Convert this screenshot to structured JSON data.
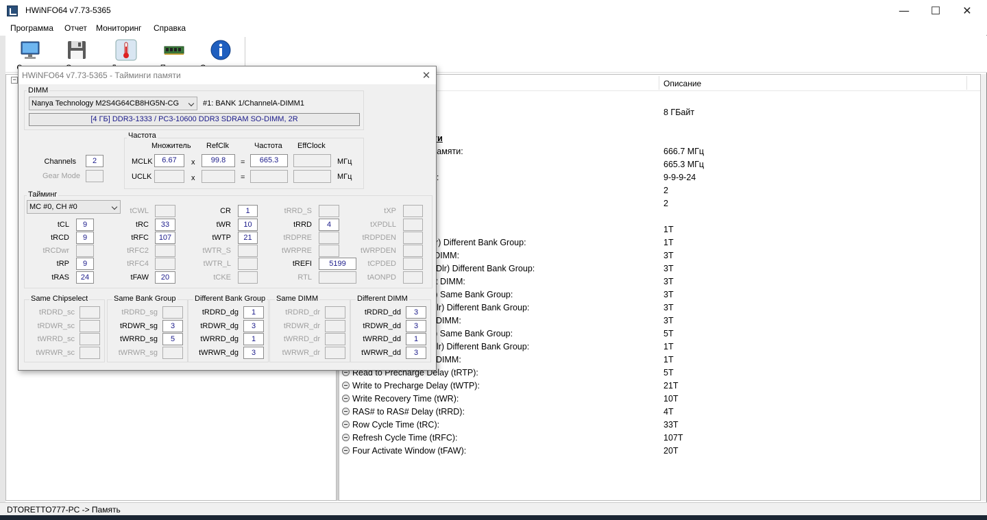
{
  "window": {
    "title": "HWiNFO64 v7.73-5365",
    "minimize": "—",
    "maximize": "☐",
    "close": "✕"
  },
  "menu": [
    "Программа",
    "Отчет",
    "Мониторинг",
    "Справка"
  ],
  "toolbar": {
    "buttons": [
      {
        "label": "Сводка",
        "icon": "monitor-icon"
      },
      {
        "label": "Отчет",
        "icon": "floppy-disk-icon"
      },
      {
        "label": "Датчики",
        "icon": "thermometer-icon"
      },
      {
        "label": "Память",
        "icon": "ram-module-icon"
      },
      {
        "label": "О программе",
        "icon": "info-icon"
      }
    ]
  },
  "tree": {
    "collapse": "−"
  },
  "right_pane": {
    "column_description": "Описание",
    "rows": [
      {
        "a": "ия",
        "b": "",
        "kind": "section"
      },
      {
        "a": ":",
        "b": "8 ГБайт",
        "kind": "plain"
      },
      {
        "a": "",
        "b": "",
        "kind": "blank"
      },
      {
        "a": " производительности",
        "b": "",
        "kind": "section"
      },
      {
        "a": "рживаемая частота памяти:",
        "b": "666.7 МГц",
        "kind": "plain"
      },
      {
        "a": "мяти:",
        "b": "665.3 МГц",
        "kind": "plain"
      },
      {
        "a": "CAS-tRCD-tRP-tRAS):",
        "b": "9-9-9-24",
        "kind": "plain"
      },
      {
        "a": "налы памяти:",
        "b": "2",
        "kind": "plain"
      },
      {
        "a": "мяти:",
        "b": "2",
        "kind": "plain"
      },
      {
        "a": "",
        "b": "",
        "kind": "blank"
      },
      {
        "a": "(CR):",
        "b": "1T",
        "kind": "plain"
      },
      {
        "a": "RDRD_DG/TrdrdScDlr) Different Bank Group:",
        "b": "1T",
        "kind": "plain"
      },
      {
        "a": "RDRD_DD) Different DIMM:",
        "b": "3T",
        "kind": "plain"
      },
      {
        "a": "tWRWR_DG/TwrwrScDlr) Different Bank Group:",
        "b": "3T",
        "kind": "plain"
      },
      {
        "a": "tWRWR_DD) Different DIMM:",
        "b": "3T",
        "kind": "plain"
      },
      {
        "a": "RDWR_SG/TrdwrScL) Same Bank Group:",
        "b": "3T",
        "kind": "plain"
      },
      {
        "a": "RDWR_DG/TrdwrScDlr) Different Bank Group:",
        "b": "3T",
        "kind": "plain"
      },
      {
        "a": "RDWR_DD) Different DIMM:",
        "b": "3T",
        "kind": "plain"
      },
      {
        "a": "WRRD_SG/TwrrdScL) Same Bank Group:",
        "b": "5T",
        "kind": "plain"
      },
      {
        "a": "WRRD_DG/TwrrdScDlr) Different Bank Group:",
        "b": "1T",
        "kind": "plain"
      },
      {
        "a": "WRRD_DD) Different DIMM:",
        "b": "1T",
        "kind": "plain"
      },
      {
        "a": "Read to Precharge Delay (tRTP):",
        "b": "5T",
        "kind": "bullet"
      },
      {
        "a": "Write to Precharge Delay (tWTP):",
        "b": "21T",
        "kind": "bullet"
      },
      {
        "a": "Write Recovery Time (tWR):",
        "b": "10T",
        "kind": "bullet"
      },
      {
        "a": "RAS# to RAS# Delay (tRRD):",
        "b": "4T",
        "kind": "bullet"
      },
      {
        "a": "Row Cycle Time (tRC):",
        "b": "33T",
        "kind": "bullet"
      },
      {
        "a": "Refresh Cycle Time (tRFC):",
        "b": "107T",
        "kind": "bullet"
      },
      {
        "a": "Four Activate Window (tFAW):",
        "b": "20T",
        "kind": "bullet"
      }
    ]
  },
  "status_bar": "DTORETTO777-PC -> Память",
  "dialog": {
    "title": "HWiNFO64 v7.73-5365 - Тайминги памяти",
    "close": "✕",
    "dimm_group": "DIMM",
    "dimm_select": "Nanya Technology M2S4G64CB8HG5N-CG",
    "dimm_slot": "#1: BANK 1/ChannelA-DIMM1",
    "dimm_info": "[4 ГБ] DDR3-1333 / PC3-10600 DDR3 SDRAM SO-DIMM, 2R",
    "channels_label": "Channels",
    "channels_value": "2",
    "gear_mode_label": "Gear Mode",
    "gear_mode_value": "",
    "freq_group": "Частота",
    "freq_headers": [
      "Множитель",
      "RefClk",
      "Частота",
      "EffClock"
    ],
    "mclk": {
      "label": "MCLK",
      "mult": "6.67",
      "x": "x",
      "refclk": "99.8",
      "eq": "=",
      "freq": "665.3",
      "eff": "",
      "unit": "МГц"
    },
    "uclk": {
      "label": "UCLK",
      "mult": "",
      "x": "x",
      "refclk": "",
      "eq": "=",
      "freq": "",
      "eff": "",
      "unit": "МГц"
    },
    "timing_group": "Тайминг",
    "mc_select": "MC #0, CH #0",
    "timings": {
      "tCL": {
        "label": "tCL",
        "value": "9",
        "active": true
      },
      "tRCD": {
        "label": "tRCD",
        "value": "9",
        "active": true
      },
      "tRCDwr": {
        "label": "tRCDwr",
        "value": "",
        "active": false
      },
      "tRP": {
        "label": "tRP",
        "value": "9",
        "active": true
      },
      "tRAS": {
        "label": "tRAS",
        "value": "24",
        "active": true
      },
      "tCWL": {
        "label": "tCWL",
        "value": "",
        "active": false
      },
      "tRC": {
        "label": "tRC",
        "value": "33",
        "active": true
      },
      "tRFC": {
        "label": "tRFC",
        "value": "107",
        "active": true
      },
      "tRFC2": {
        "label": "tRFC2",
        "value": "",
        "active": false
      },
      "tRFC4": {
        "label": "tRFC4",
        "value": "",
        "active": false
      },
      "tFAW": {
        "label": "tFAW",
        "value": "20",
        "active": true
      },
      "CR": {
        "label": "CR",
        "value": "1",
        "active": true
      },
      "tWR": {
        "label": "tWR",
        "value": "10",
        "active": true
      },
      "tWTP": {
        "label": "tWTP",
        "value": "21",
        "active": true
      },
      "tWTR_S": {
        "label": "tWTR_S",
        "value": "",
        "active": false
      },
      "tWTR_L": {
        "label": "tWTR_L",
        "value": "",
        "active": false
      },
      "tCKE": {
        "label": "tCKE",
        "value": "",
        "active": false
      },
      "tRRD_S": {
        "label": "tRRD_S",
        "value": "",
        "active": false
      },
      "tRRD": {
        "label": "tRRD",
        "value": "4",
        "active": true
      },
      "tRDPRE": {
        "label": "tRDPRE",
        "value": "",
        "active": false
      },
      "tWRPRE": {
        "label": "tWRPRE",
        "value": "",
        "active": false
      },
      "tREFI": {
        "label": "tREFI",
        "value": "5199",
        "active": true
      },
      "RTL": {
        "label": "RTL",
        "value": "",
        "active": false
      },
      "tXP": {
        "label": "tXP",
        "value": "",
        "active": false
      },
      "tXPDLL": {
        "label": "tXPDLL",
        "value": "",
        "active": false
      },
      "tRDPDEN": {
        "label": "tRDPDEN",
        "value": "",
        "active": false
      },
      "tWRPDEN": {
        "label": "tWRPDEN",
        "value": "",
        "active": false
      },
      "tCPDED": {
        "label": "tCPDED",
        "value": "",
        "active": false
      },
      "tAONPD": {
        "label": "tAONPD",
        "value": "",
        "active": false
      }
    },
    "groups": [
      {
        "title": "Same Chipselect",
        "items": [
          {
            "label": "tRDRD_sc",
            "value": "",
            "active": false
          },
          {
            "label": "tRDWR_sc",
            "value": "",
            "active": false
          },
          {
            "label": "tWRRD_sc",
            "value": "",
            "active": false
          },
          {
            "label": "tWRWR_sc",
            "value": "",
            "active": false
          }
        ]
      },
      {
        "title": "Same Bank Group",
        "items": [
          {
            "label": "tRDRD_sg",
            "value": "",
            "active": false
          },
          {
            "label": "tRDWR_sg",
            "value": "3",
            "active": true
          },
          {
            "label": "tWRRD_sg",
            "value": "5",
            "active": true
          },
          {
            "label": "tWRWR_sg",
            "value": "",
            "active": false
          }
        ]
      },
      {
        "title": "Different Bank Group",
        "items": [
          {
            "label": "tRDRD_dg",
            "value": "1",
            "active": true
          },
          {
            "label": "tRDWR_dg",
            "value": "3",
            "active": true
          },
          {
            "label": "tWRRD_dg",
            "value": "1",
            "active": true
          },
          {
            "label": "tWRWR_dg",
            "value": "3",
            "active": true
          }
        ]
      },
      {
        "title": "Same DIMM",
        "items": [
          {
            "label": "tRDRD_dr",
            "value": "",
            "active": false
          },
          {
            "label": "tRDWR_dr",
            "value": "",
            "active": false
          },
          {
            "label": "tWRRD_dr",
            "value": "",
            "active": false
          },
          {
            "label": "tWRWR_dr",
            "value": "",
            "active": false
          }
        ]
      },
      {
        "title": "Different DIMM",
        "items": [
          {
            "label": "tRDRD_dd",
            "value": "3",
            "active": true
          },
          {
            "label": "tRDWR_dd",
            "value": "3",
            "active": true
          },
          {
            "label": "tWRRD_dd",
            "value": "1",
            "active": true
          },
          {
            "label": "tWRWR_dd",
            "value": "3",
            "active": true
          }
        ]
      }
    ]
  }
}
